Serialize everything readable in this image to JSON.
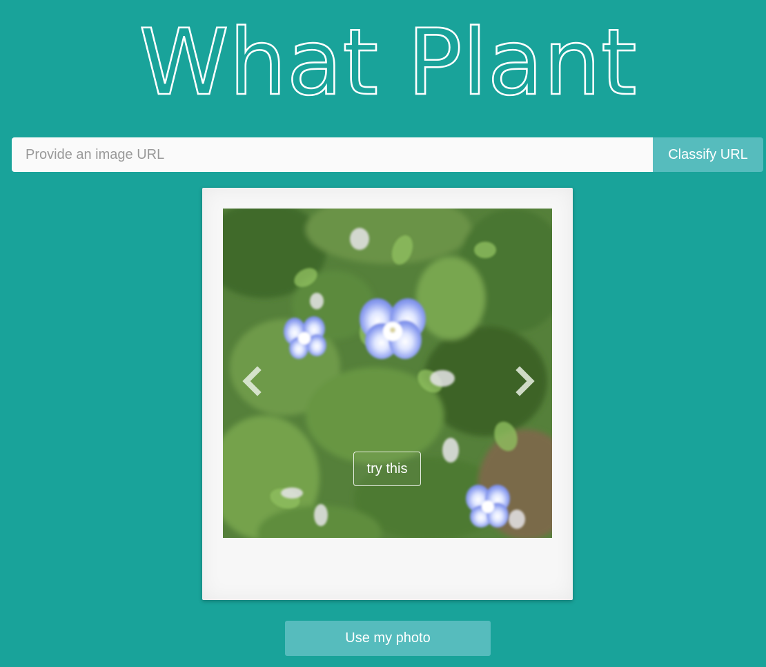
{
  "header": {
    "title": "What Plant"
  },
  "search": {
    "placeholder": "Provide an image URL",
    "value": "",
    "button_label": "Classify URL"
  },
  "carousel": {
    "prev_icon": "chevron-left-icon",
    "next_icon": "chevron-right-icon",
    "try_label": "try this"
  },
  "actions": {
    "use_photo_label": "Use my photo"
  },
  "colors": {
    "background": "#19a39a",
    "button": "#56bcbd",
    "card": "#f7f7f7",
    "input": "#fafafa"
  }
}
